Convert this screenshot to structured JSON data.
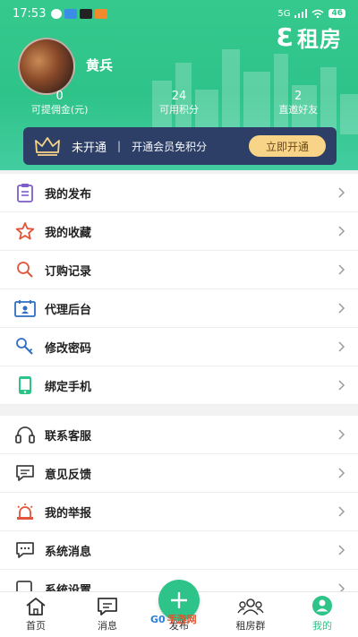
{
  "status_bar": {
    "time": "17:53",
    "network": "5G",
    "battery": "46"
  },
  "brand": {
    "mark": "Ɛ",
    "name": "租房"
  },
  "user": {
    "name": "黄兵"
  },
  "stats": [
    {
      "value": "0",
      "label": "可提佣金(元)"
    },
    {
      "value": "24",
      "label": "可用积分"
    },
    {
      "value": "2",
      "label": "直邀好友"
    }
  ],
  "vip": {
    "status": "未开通",
    "separator": "|",
    "desc": "开通会员免积分",
    "button": "立即开通"
  },
  "menu_primary": [
    {
      "label": "我的发布",
      "icon": "clipboard-icon"
    },
    {
      "label": "我的收藏",
      "icon": "star-icon"
    },
    {
      "label": "订购记录",
      "icon": "search-icon"
    },
    {
      "label": "代理后台",
      "icon": "calendar-icon"
    },
    {
      "label": "修改密码",
      "icon": "key-icon"
    },
    {
      "label": "绑定手机",
      "icon": "phone-icon"
    }
  ],
  "menu_secondary": [
    {
      "label": "联系客服",
      "icon": "headset-icon"
    },
    {
      "label": "意见反馈",
      "icon": "feedback-icon"
    },
    {
      "label": "我的举报",
      "icon": "alarm-icon"
    },
    {
      "label": "系统消息",
      "icon": "message-icon"
    },
    {
      "label": "系统设置",
      "icon": "settings-icon"
    }
  ],
  "tabs": [
    {
      "label": "首页",
      "icon": "home-icon"
    },
    {
      "label": "消息",
      "icon": "chat-icon"
    },
    {
      "label": "发布",
      "icon": "plus-icon"
    },
    {
      "label": "租房群",
      "icon": "group-icon"
    },
    {
      "label": "我的",
      "icon": "user-icon"
    }
  ],
  "watermark": {
    "left": "G0",
    "right": "手游网"
  },
  "colors": {
    "brand_green": "#2ec389",
    "vip_bg": "#2d3f66",
    "vip_button": "#f7d487"
  }
}
